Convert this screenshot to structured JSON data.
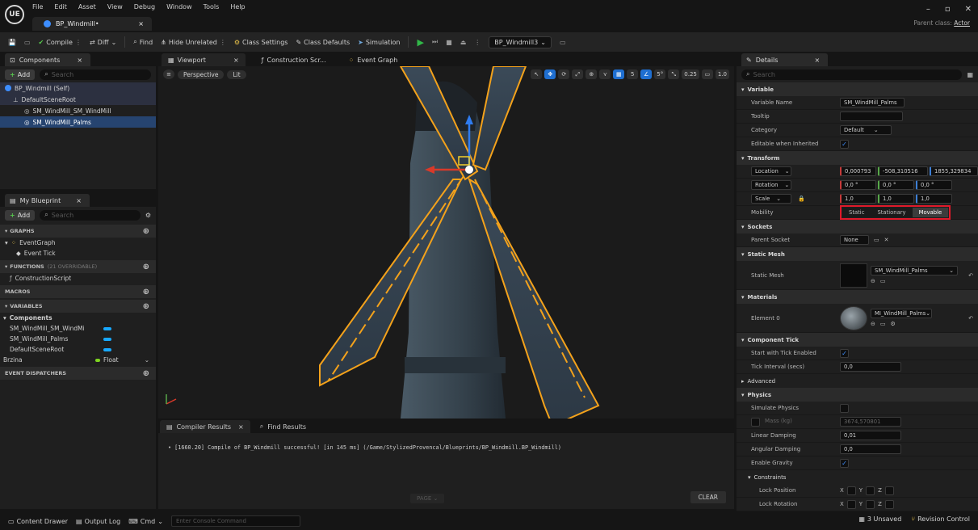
{
  "window": {
    "logo": "UE",
    "menu": [
      "File",
      "Edit",
      "Asset",
      "View",
      "Debug",
      "Window",
      "Tools",
      "Help"
    ],
    "doc_tab": "BP_Windmill•",
    "parent_class_label": "Parent class:",
    "parent_class_value": "Actor"
  },
  "toolbar": {
    "compile": "Compile",
    "diff": "Diff",
    "find": "Find",
    "hide_unrelated": "Hide Unrelated",
    "class_settings": "Class Settings",
    "class_defaults": "Class Defaults",
    "simulation": "Simulation",
    "debug_target": "BP_Windmill3"
  },
  "components": {
    "tab": "Components",
    "add": "Add",
    "search_placeholder": "Search",
    "items": [
      "BP_Windmill (Self)",
      "DefaultSceneRoot",
      "SM_WindMill_SM_WindMill",
      "SM_WindMill_Palms"
    ]
  },
  "my_blueprint": {
    "tab": "My Blueprint",
    "add": "Add",
    "search_placeholder": "Search",
    "graphs": "GRAPHS",
    "event_graph": "EventGraph",
    "event_tick": "Event Tick",
    "functions": "FUNCTIONS",
    "functions_sub": "(21 OVERRIDABLE)",
    "construction_script": "ConstructionScript",
    "macros": "MACROS",
    "variables": "VARIABLES",
    "components_group": "Components",
    "var_items": [
      "SM_WindMill_SM_WindMi",
      "SM_WindMill_Palms",
      "DefaultSceneRoot"
    ],
    "brzina": "Brzina",
    "brzina_type": "Float",
    "event_dispatchers": "EVENT DISPATCHERS"
  },
  "viewport": {
    "tabs": [
      "Viewport",
      "Construction Scr...",
      "Event Graph"
    ],
    "perspective": "Perspective",
    "lit": "Lit",
    "grid_snap": "5",
    "angle_snap": "5°",
    "scale_snap": "0.25",
    "camera_speed": "1.0"
  },
  "compiler": {
    "tab_results": "Compiler Results",
    "tab_find": "Find Results",
    "message": "• [1660.20] Compile of BP_Windmill successful! [in 145 ms] (/Game/StylizedProvencal/Blueprints/BP_Windmill.BP_Windmill)",
    "page": "PAGE",
    "clear": "CLEAR"
  },
  "details": {
    "tab": "Details",
    "search_placeholder": "Search",
    "sections": {
      "variable": "Variable",
      "transform": "Transform",
      "sockets": "Sockets",
      "static_mesh": "Static Mesh",
      "materials": "Materials",
      "component_tick": "Component Tick",
      "advanced": "Advanced",
      "physics": "Physics",
      "constraints": "Constraints"
    },
    "variable_name_label": "Variable Name",
    "variable_name": "SM_WindMill_Palms",
    "tooltip_label": "Tooltip",
    "category_label": "Category",
    "category": "Default",
    "editable_label": "Editable when Inherited",
    "location_label": "Location",
    "location": [
      "0,000793",
      "-508,310516",
      "1855,329834"
    ],
    "rotation_label": "Rotation",
    "rotation": [
      "0,0 °",
      "0,0 °",
      "0,0 °"
    ],
    "scale_label": "Scale",
    "scale": [
      "1,0",
      "1,0",
      "1,0"
    ],
    "mobility_label": "Mobility",
    "mobility": [
      "Static",
      "Stationary",
      "Movable"
    ],
    "parent_socket_label": "Parent Socket",
    "parent_socket": "None",
    "static_mesh_label": "Static Mesh",
    "static_mesh": "SM_WindMill_Palms",
    "element0_label": "Element 0",
    "element0": "MI_WindMill_Palms",
    "start_tick_label": "Start with Tick Enabled",
    "tick_interval_label": "Tick Interval (secs)",
    "tick_interval": "0,0",
    "simulate_physics_label": "Simulate Physics",
    "mass_label": "Mass (kg)",
    "mass": "3674,570801",
    "linear_damping_label": "Linear Damping",
    "linear_damping": "0,01",
    "angular_damping_label": "Angular Damping",
    "angular_damping": "0,0",
    "enable_gravity_label": "Enable Gravity",
    "lock_position_label": "Lock Position",
    "lock_rotation_label": "Lock Rotation",
    "axes": [
      "X",
      "Y",
      "Z"
    ]
  },
  "statusbar": {
    "content_drawer": "Content Drawer",
    "output_log": "Output Log",
    "cmd": "Cmd",
    "console_placeholder": "Enter Console Command",
    "unsaved": "3 Unsaved",
    "revision_control": "Revision Control"
  },
  "colors": {
    "accent_blue": "#264470",
    "play_green": "#31b848",
    "selection_orange": "#f4a21b",
    "highlight_red": "#e0192a"
  }
}
